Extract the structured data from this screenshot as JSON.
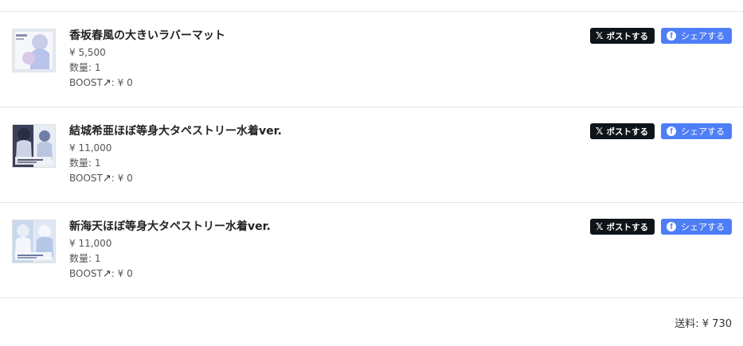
{
  "items": [
    {
      "name": "香坂春風の大きいラバーマット",
      "price": "¥ 5,500",
      "quantity": "数量: 1",
      "boost_label": "BOOST",
      "boost_value": ": ¥ 0",
      "x_share_label": "ポストする",
      "fb_share_label": "シェアする"
    },
    {
      "name": "結城希亜ほぼ等身大タペストリー水着ver.",
      "price": "¥ 11,000",
      "quantity": "数量: 1",
      "boost_label": "BOOST",
      "boost_value": ": ¥ 0",
      "x_share_label": "ポストする",
      "fb_share_label": "シェアする"
    },
    {
      "name": "新海天ほぼ等身大タペストリー水着ver.",
      "price": "¥ 11,000",
      "quantity": "数量: 1",
      "boost_label": "BOOST",
      "boost_value": ": ¥ 0",
      "x_share_label": "ポストする",
      "fb_share_label": "シェアする"
    }
  ],
  "icons": {
    "x_logo": "x-logo-icon",
    "facebook_logo": "facebook-icon",
    "boost_arrow": "arrow-up-right-icon"
  },
  "colors": {
    "x_button_bg": "#0f1419",
    "facebook_button_bg": "#4e7ef7",
    "divider": "#e5e5e5"
  },
  "shipping": {
    "text": "送料: ¥ 730"
  }
}
